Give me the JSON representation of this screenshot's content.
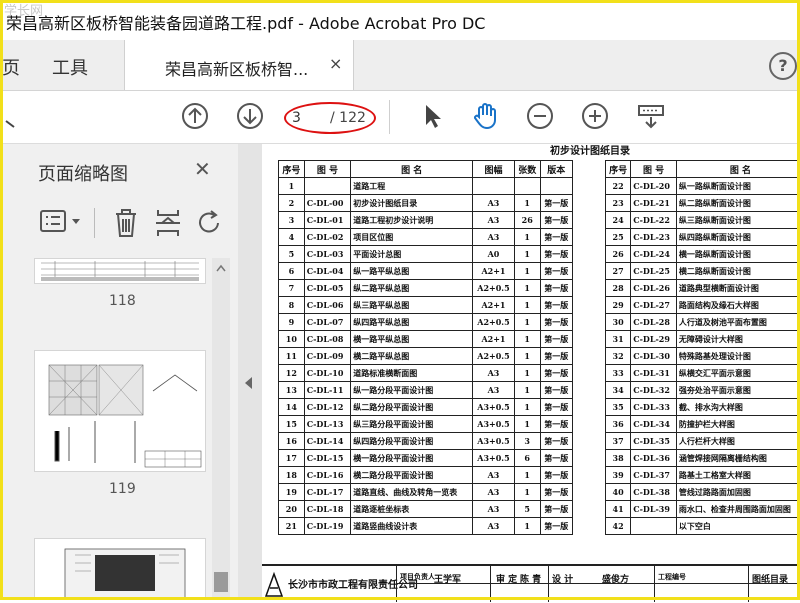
{
  "window": {
    "title": "荣昌高新区板桥智能装备园道路工程.pdf - Adobe Acrobat Pro DC",
    "watermark": "学长网"
  },
  "menu": {
    "items": [
      "页",
      "工具"
    ]
  },
  "tab": {
    "label": "荣昌高新区板桥智...",
    "close": "×"
  },
  "help": "?",
  "toolbar": {
    "page_current": "3",
    "page_total": "/ 122"
  },
  "left_panel": {
    "title": "页面缩略图",
    "close": "✕",
    "thumbs": [
      {
        "label": "118"
      },
      {
        "label": "119"
      }
    ]
  },
  "sheet_left": {
    "headers": [
      "序号",
      "图  号",
      "图          名",
      "图幅",
      "张数",
      "版本"
    ],
    "rows": [
      [
        "1",
        "",
        "道路工程",
        "",
        "",
        ""
      ],
      [
        "2",
        "C-DL-00",
        "初步设计图纸目录",
        "A3",
        "1",
        "第一版"
      ],
      [
        "3",
        "C-DL-01",
        "道路工程初步设计说明",
        "A3",
        "26",
        "第一版"
      ],
      [
        "4",
        "C-DL-02",
        "项目区位图",
        "A3",
        "1",
        "第一版"
      ],
      [
        "5",
        "C-DL-03",
        "平面设计总图",
        "A0",
        "1",
        "第一版"
      ],
      [
        "6",
        "C-DL-04",
        "纵一路平纵总图",
        "A2+1",
        "1",
        "第一版"
      ],
      [
        "7",
        "C-DL-05",
        "纵二路平纵总图",
        "A2+0.5",
        "1",
        "第一版"
      ],
      [
        "8",
        "C-DL-06",
        "纵三路平纵总图",
        "A2+1",
        "1",
        "第一版"
      ],
      [
        "9",
        "C-DL-07",
        "纵四路平纵总图",
        "A2+0.5",
        "1",
        "第一版"
      ],
      [
        "10",
        "C-DL-08",
        "横一路平纵总图",
        "A2+1",
        "1",
        "第一版"
      ],
      [
        "11",
        "C-DL-09",
        "横二路平纵总图",
        "A2+0.5",
        "1",
        "第一版"
      ],
      [
        "12",
        "C-DL-10",
        "道路标准横断面图",
        "A3",
        "1",
        "第一版"
      ],
      [
        "13",
        "C-DL-11",
        "纵一路分段平面设计图",
        "A3",
        "1",
        "第一版"
      ],
      [
        "14",
        "C-DL-12",
        "纵二路分段平面设计图",
        "A3+0.5",
        "1",
        "第一版"
      ],
      [
        "15",
        "C-DL-13",
        "纵三路分段平面设计图",
        "A3+0.5",
        "1",
        "第一版"
      ],
      [
        "16",
        "C-DL-14",
        "纵四路分段平面设计图",
        "A3+0.5",
        "3",
        "第一版"
      ],
      [
        "17",
        "C-DL-15",
        "横一路分段平面设计图",
        "A3+0.5",
        "6",
        "第一版"
      ],
      [
        "18",
        "C-DL-16",
        "横二路分段平面设计图",
        "A3",
        "1",
        "第一版"
      ],
      [
        "19",
        "C-DL-17",
        "道路直线、曲线及转角一览表",
        "A3",
        "1",
        "第一版"
      ],
      [
        "20",
        "C-DL-18",
        "道路逐桩坐标表",
        "A3",
        "5",
        "第一版"
      ],
      [
        "21",
        "C-DL-19",
        "道路竖曲线设计表",
        "A3",
        "1",
        "第一版"
      ]
    ]
  },
  "sheet_right": {
    "headers": [
      "序号",
      "图  号",
      "图          名"
    ],
    "rows": [
      [
        "22",
        "C-DL-20",
        "纵一路纵断面设计图"
      ],
      [
        "23",
        "C-DL-21",
        "纵二路纵断面设计图"
      ],
      [
        "24",
        "C-DL-22",
        "纵三路纵断面设计图"
      ],
      [
        "25",
        "C-DL-23",
        "纵四路纵断面设计图"
      ],
      [
        "26",
        "C-DL-24",
        "横一路纵断面设计图"
      ],
      [
        "27",
        "C-DL-25",
        "横二路纵断面设计图"
      ],
      [
        "28",
        "C-DL-26",
        "道路典型横断面设计图"
      ],
      [
        "29",
        "C-DL-27",
        "路面结构及缘石大样图"
      ],
      [
        "30",
        "C-DL-28",
        "人行道及树池平面布置图"
      ],
      [
        "31",
        "C-DL-29",
        "无障碍设计大样图"
      ],
      [
        "32",
        "C-DL-30",
        "特殊路基处理设计图"
      ],
      [
        "33",
        "C-DL-31",
        "纵横交汇平面示意图"
      ],
      [
        "34",
        "C-DL-32",
        "强夯处治平面示意图"
      ],
      [
        "35",
        "C-DL-33",
        "截、排水沟大样图"
      ],
      [
        "36",
        "C-DL-34",
        "防撞护栏大样图"
      ],
      [
        "37",
        "C-DL-35",
        "人行栏杆大样图"
      ],
      [
        "38",
        "C-DL-36",
        "涵管焊接网隔离栅结构图"
      ],
      [
        "39",
        "C-DL-37",
        "路基土工格室大样图"
      ],
      [
        "40",
        "C-DL-38",
        "管线过路路面加固图"
      ],
      [
        "41",
        "C-DL-39",
        "雨水口、检查井周围路面加固图"
      ],
      [
        "42",
        "",
        "以下空白"
      ]
    ]
  },
  "footer": {
    "company": "长沙市市政工程有限责任公司",
    "cells": [
      "项目负责人",
      "王学军",
      "审 定",
      "陈 青",
      "设 计",
      "盛俊方",
      "工程编号",
      "图纸目录"
    ],
    "sheet_title_top": "初步设计图纸目录"
  }
}
